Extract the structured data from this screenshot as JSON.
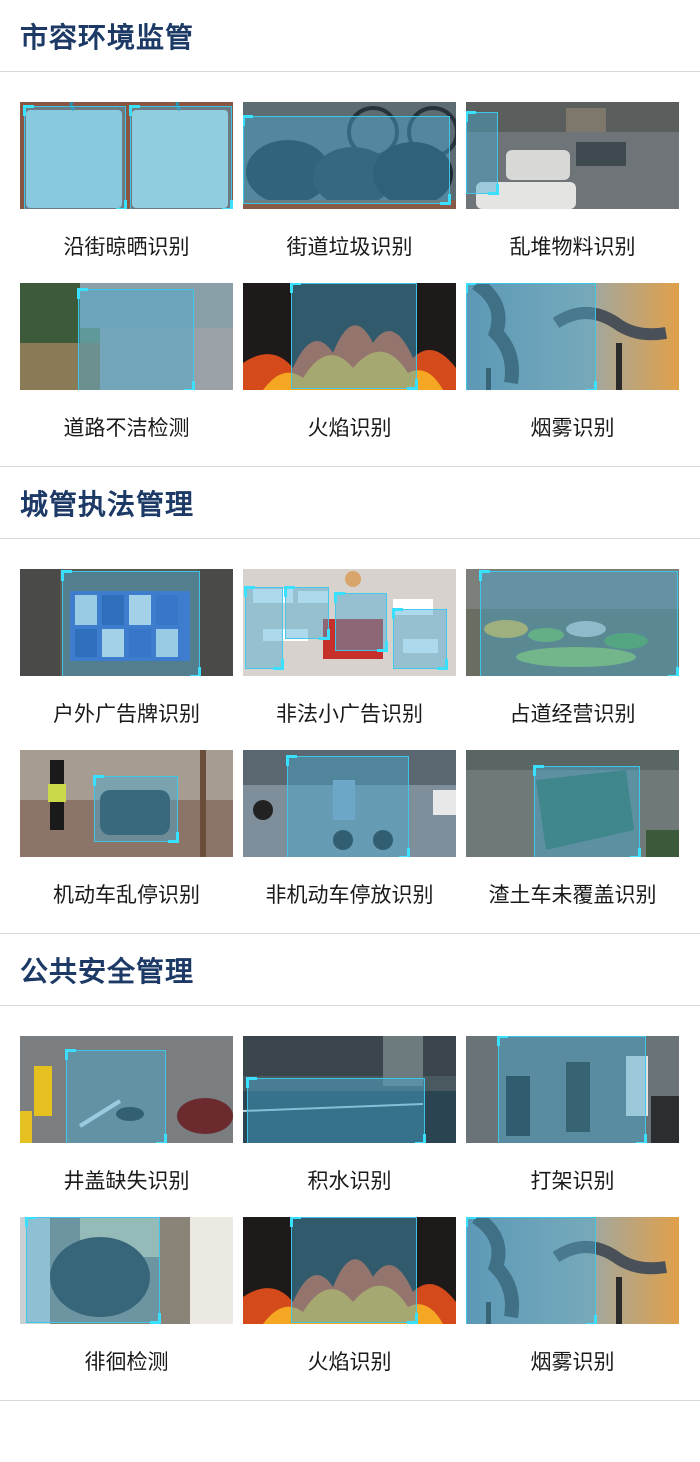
{
  "sections": [
    {
      "title": "市容环境监管",
      "items": [
        {
          "label": "沿街晾晒识别",
          "scene": "drying"
        },
        {
          "label": "街道垃圾识别",
          "scene": "garbage"
        },
        {
          "label": "乱堆物料识别",
          "scene": "piling"
        },
        {
          "label": "道路不洁检测",
          "scene": "dirty-road"
        },
        {
          "label": "火焰识别",
          "scene": "fire"
        },
        {
          "label": "烟雾识别",
          "scene": "smoke"
        }
      ]
    },
    {
      "title": "城管执法管理",
      "items": [
        {
          "label": "户外广告牌识别",
          "scene": "billboard"
        },
        {
          "label": "非法小广告识别",
          "scene": "flyers"
        },
        {
          "label": "占道经营识别",
          "scene": "street-vendor"
        },
        {
          "label": "机动车乱停识别",
          "scene": "car-parking"
        },
        {
          "label": "非机动车停放识别",
          "scene": "ebike-parking"
        },
        {
          "label": "渣土车未覆盖识别",
          "scene": "truck"
        }
      ]
    },
    {
      "title": "公共安全管理",
      "items": [
        {
          "label": "井盖缺失识别",
          "scene": "manhole"
        },
        {
          "label": "积水识别",
          "scene": "water"
        },
        {
          "label": "打架识别",
          "scene": "fight"
        },
        {
          "label": "徘徊检测",
          "scene": "loitering"
        },
        {
          "label": "火焰识别",
          "scene": "fire"
        },
        {
          "label": "烟雾识别",
          "scene": "smoke"
        }
      ]
    }
  ]
}
